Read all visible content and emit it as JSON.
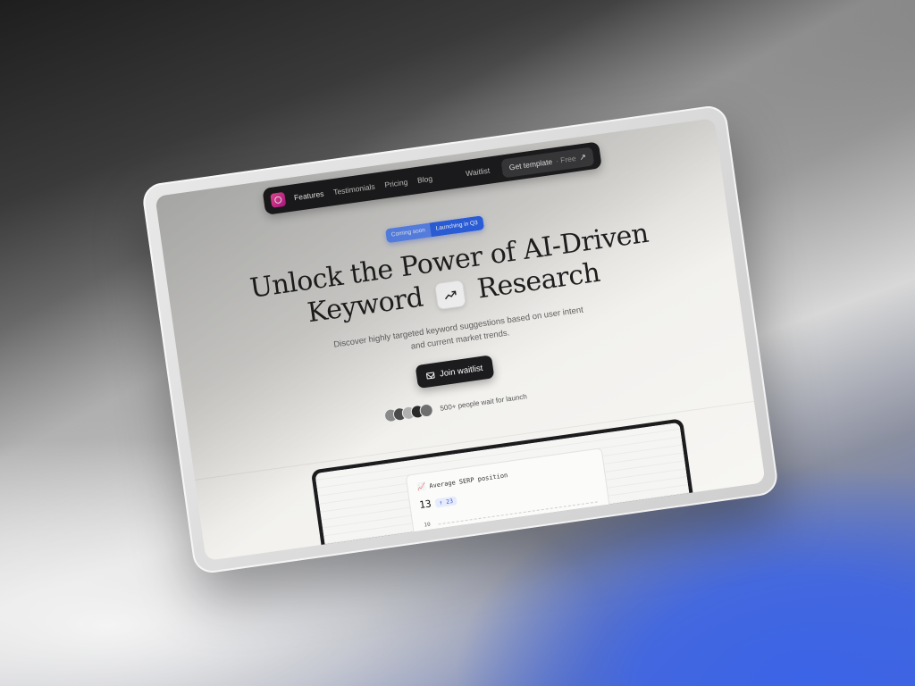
{
  "nav": {
    "links": [
      "Features",
      "Testimonials",
      "Pricing",
      "Blog"
    ],
    "waitlist": "Waitlist",
    "template_button": "Get template",
    "template_free": "· Free"
  },
  "badge": {
    "left": "Coming soon",
    "right": "Launching in Q3"
  },
  "hero": {
    "headline_line1": "Unlock the Power of AI-Driven",
    "headline_line2_a": "Keyword",
    "headline_line2_b": "Research",
    "subtext_line1": "Discover highly targeted keyword suggestions based on user intent",
    "subtext_line2": "and current market trends.",
    "cta": "Join waitlist",
    "social_proof": "500+ people wait for launch"
  },
  "preview": {
    "card_title": "Average SERP position",
    "value": "13",
    "delta": "23",
    "tick": "10"
  },
  "colors": {
    "accent_blue": "#2d63e6",
    "logo_pink": "#e0248f",
    "nav_bg": "#1d1d1f"
  }
}
